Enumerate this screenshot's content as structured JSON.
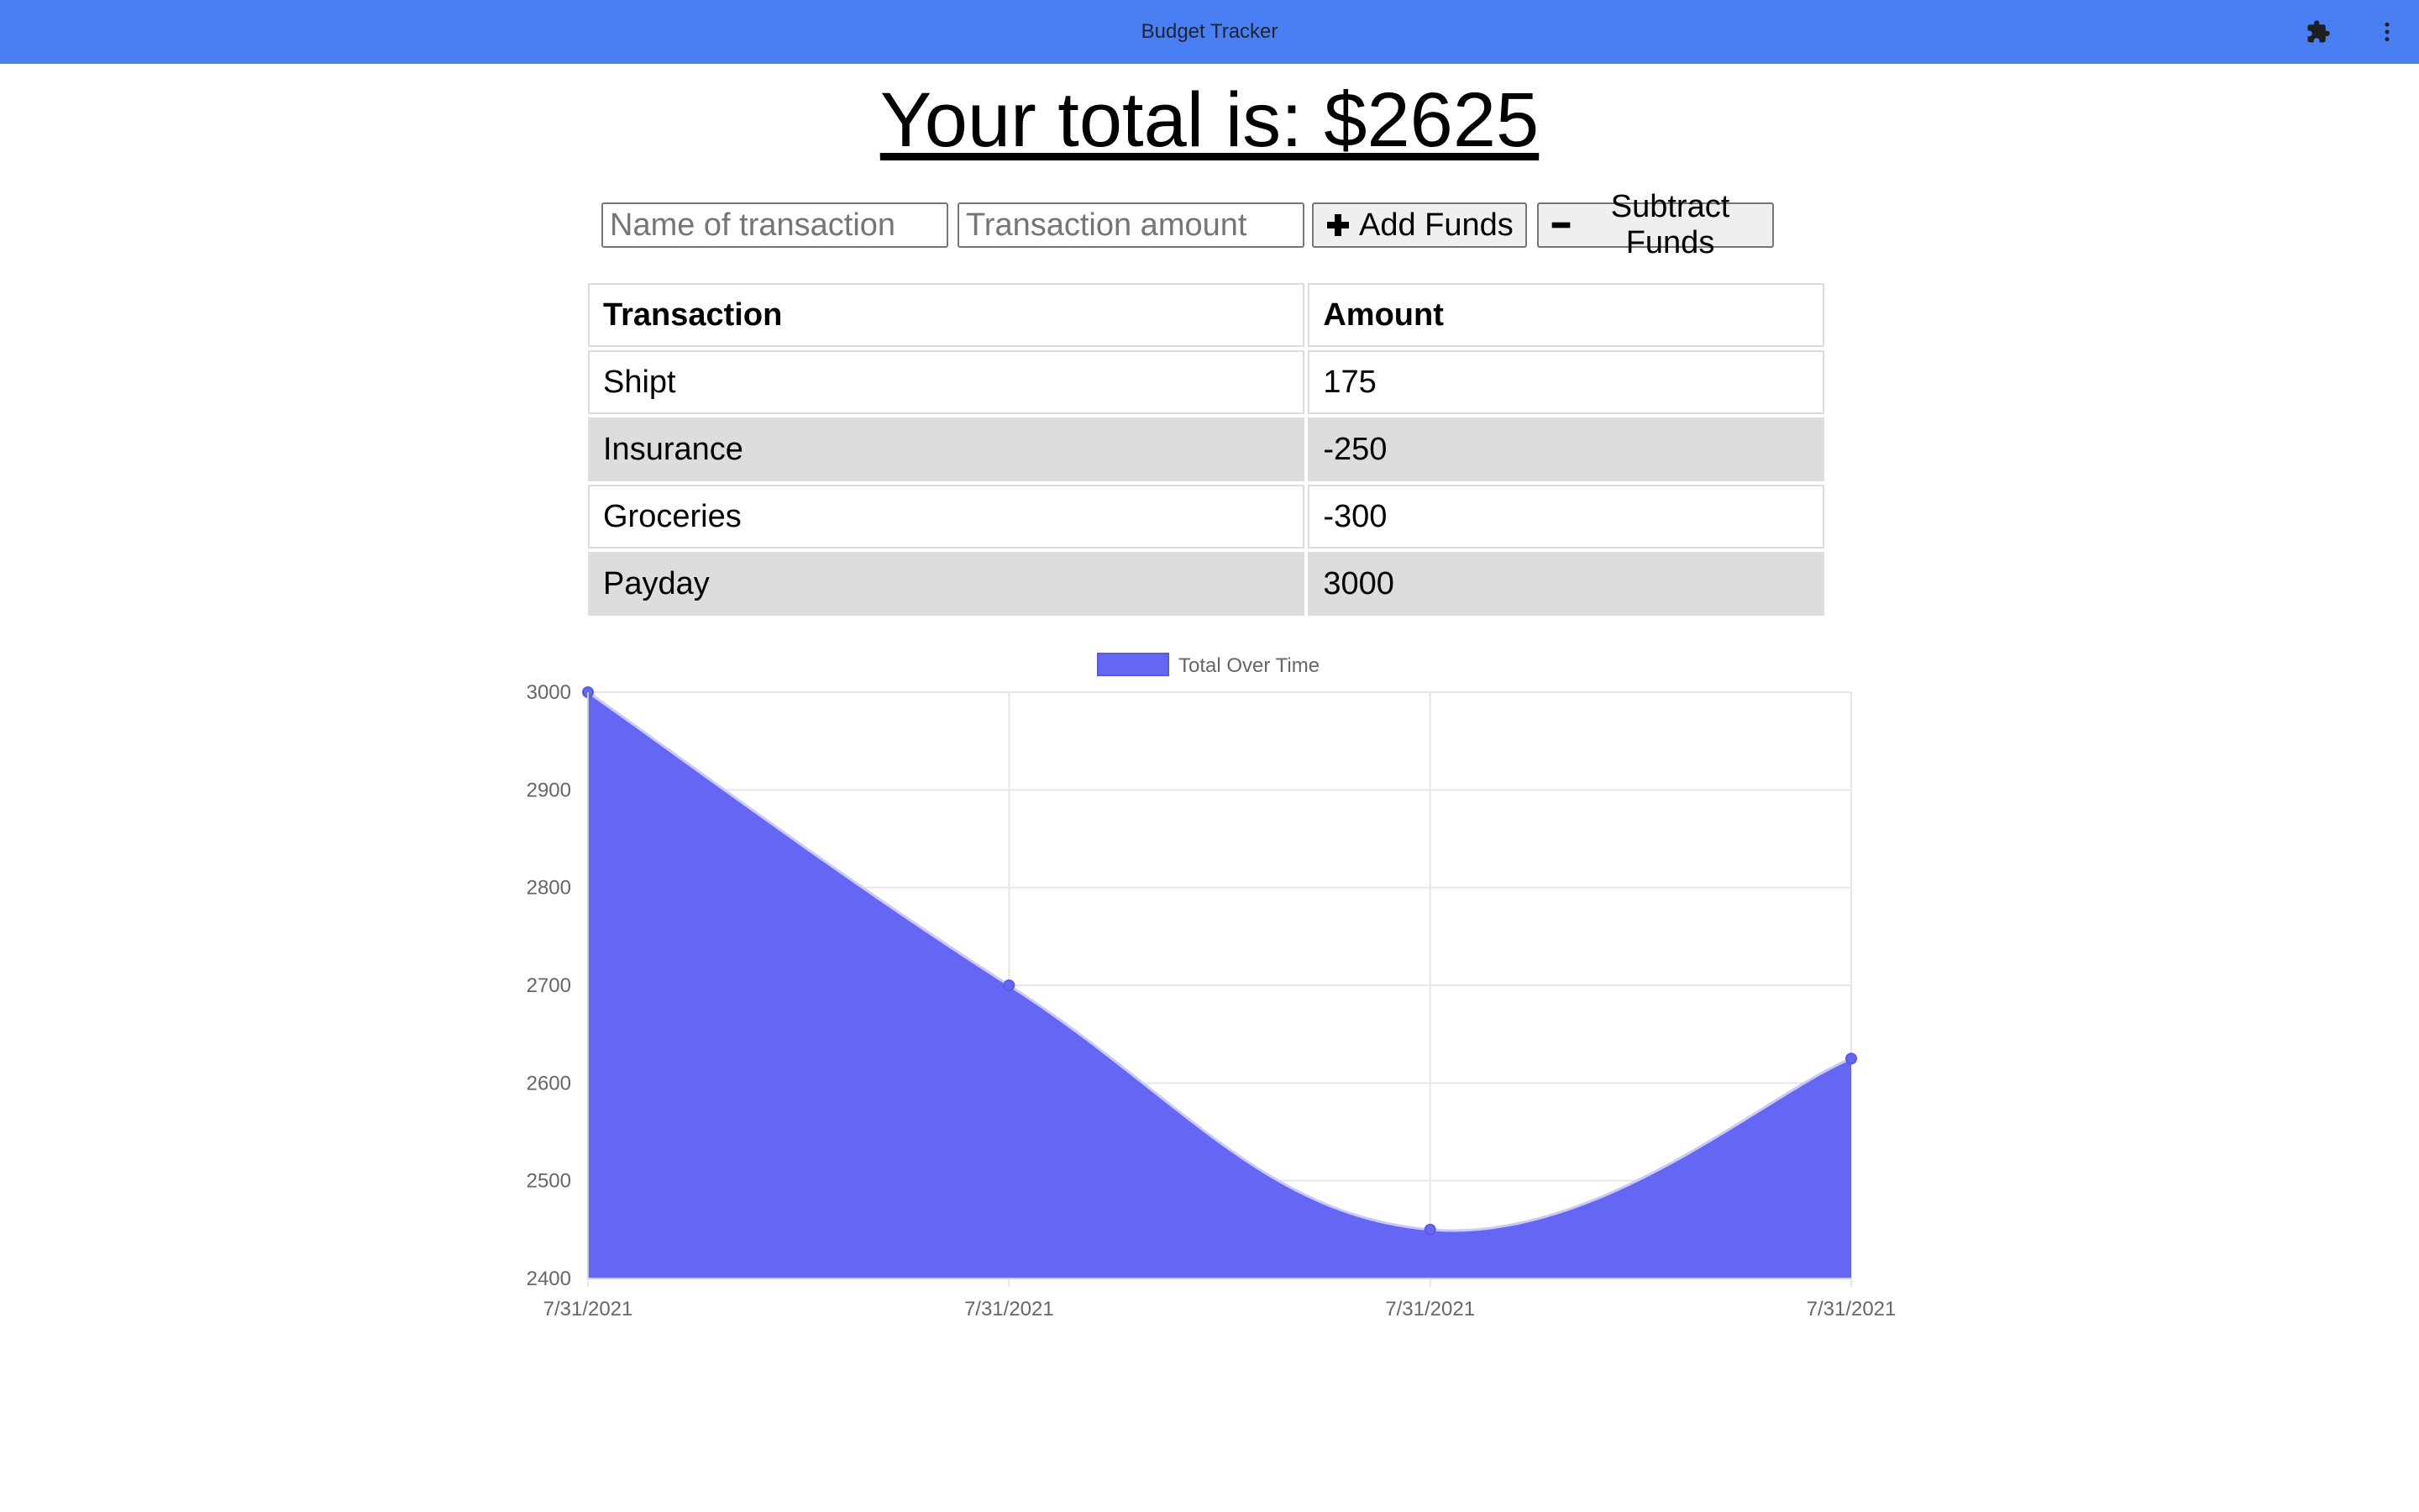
{
  "window": {
    "title": "Budget Tracker",
    "extension_icon": "puzzle-icon",
    "menu_icon": "more-vert-icon"
  },
  "header": {
    "total_prefix": "Your total is: $",
    "total_value": "2625"
  },
  "form": {
    "name_placeholder": "Name of transaction",
    "amount_placeholder": "Transaction amount",
    "add_label": "Add Funds",
    "subtract_label": "Subtract Funds"
  },
  "table": {
    "headers": [
      "Transaction",
      "Amount"
    ],
    "rows": [
      {
        "name": "Shipt",
        "amount": "175"
      },
      {
        "name": "Insurance",
        "amount": "-250"
      },
      {
        "name": "Groceries",
        "amount": "-300"
      },
      {
        "name": "Payday",
        "amount": "3000"
      }
    ]
  },
  "chart_data": {
    "type": "area",
    "x": [
      "7/31/2021",
      "7/31/2021",
      "7/31/2021",
      "7/31/2021"
    ],
    "series": [
      {
        "name": "Total Over Time",
        "values": [
          3000,
          2700,
          2450,
          2625
        ],
        "color": "#6666f4"
      }
    ],
    "ylim": [
      2400,
      3000
    ],
    "yticks": [
      3000,
      2900,
      2800,
      2700,
      2600,
      2500,
      2400
    ],
    "grid": true,
    "legend": "top-center"
  },
  "colors": {
    "titlebar": "#4a7ff3",
    "series_fill": "#6666f4",
    "row_alt": "#dddddd"
  }
}
